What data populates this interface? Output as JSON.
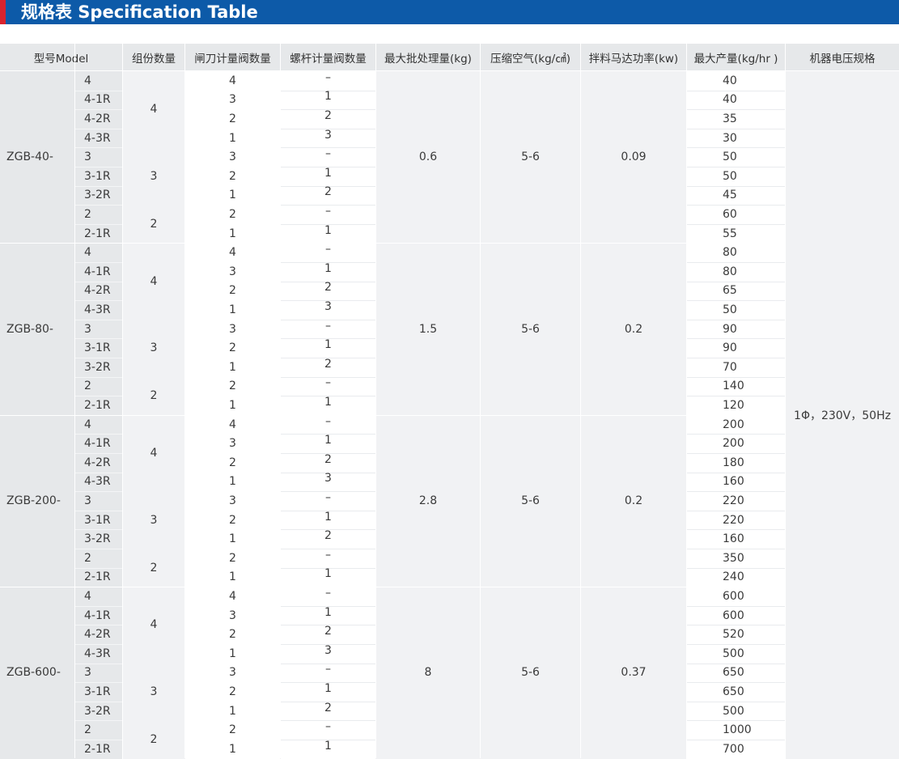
{
  "banner": {
    "title": "规格表 Specification Table",
    "accent_color": "#d9232e",
    "bg_color": "#0d5aa8"
  },
  "headers": {
    "model": "型号Model",
    "groups": "组份数量",
    "gate_valves": "闸刀计量阀数量",
    "screw_valves": "螺杆计量阀数量",
    "max_batch": "最大批处理量(kg)",
    "air": "压缩空气(kg/㎠)",
    "motor": "拌料马达功率(kw)",
    "max_output": "最大产量(kg/hr )",
    "voltage": "机器电压规格"
  },
  "voltage_value": "1Φ，230V，50Hz",
  "models": [
    {
      "name": "ZGB-40-",
      "batch": "0.6",
      "air": "5-6",
      "motor": "0.09",
      "rows": [
        {
          "sub": "4",
          "group": "4",
          "gate": "4",
          "screw": "–",
          "output": "40"
        },
        {
          "sub": "4-1R",
          "group": "4",
          "gate": "3",
          "screw": "1",
          "output": "40"
        },
        {
          "sub": "4-2R",
          "group": "4",
          "gate": "2",
          "screw": "2",
          "output": "35"
        },
        {
          "sub": "4-3R",
          "group": "4",
          "gate": "1",
          "screw": "3",
          "output": "30"
        },
        {
          "sub": "3",
          "group": "3",
          "gate": "3",
          "screw": "–",
          "output": "50"
        },
        {
          "sub": "3-1R",
          "group": "3",
          "gate": "2",
          "screw": "1",
          "output": "50"
        },
        {
          "sub": "3-2R",
          "group": "3",
          "gate": "1",
          "screw": "2",
          "output": "45"
        },
        {
          "sub": "2",
          "group": "2",
          "gate": "2",
          "screw": "–",
          "output": "60"
        },
        {
          "sub": "2-1R",
          "group": "2",
          "gate": "1",
          "screw": "1",
          "output": "55"
        }
      ]
    },
    {
      "name": "ZGB-80-",
      "batch": "1.5",
      "air": "5-6",
      "motor": "0.2",
      "rows": [
        {
          "sub": "4",
          "group": "4",
          "gate": "4",
          "screw": "–",
          "output": "80"
        },
        {
          "sub": "4-1R",
          "group": "4",
          "gate": "3",
          "screw": "1",
          "output": "80"
        },
        {
          "sub": "4-2R",
          "group": "4",
          "gate": "2",
          "screw": "2",
          "output": "65"
        },
        {
          "sub": "4-3R",
          "group": "4",
          "gate": "1",
          "screw": "3",
          "output": "50"
        },
        {
          "sub": "3",
          "group": "3",
          "gate": "3",
          "screw": "–",
          "output": "90"
        },
        {
          "sub": "3-1R",
          "group": "3",
          "gate": "2",
          "screw": "1",
          "output": "90"
        },
        {
          "sub": "3-2R",
          "group": "3",
          "gate": "1",
          "screw": "2",
          "output": "70"
        },
        {
          "sub": "2",
          "group": "2",
          "gate": "2",
          "screw": "–",
          "output": "140"
        },
        {
          "sub": "2-1R",
          "group": "2",
          "gate": "1",
          "screw": "1",
          "output": "120"
        }
      ]
    },
    {
      "name": "ZGB-200-",
      "batch": "2.8",
      "air": "5-6",
      "motor": "0.2",
      "rows": [
        {
          "sub": "4",
          "group": "4",
          "gate": "4",
          "screw": "–",
          "output": "200"
        },
        {
          "sub": "4-1R",
          "group": "4",
          "gate": "3",
          "screw": "1",
          "output": "200"
        },
        {
          "sub": "4-2R",
          "group": "4",
          "gate": "2",
          "screw": "2",
          "output": "180"
        },
        {
          "sub": "4-3R",
          "group": "4",
          "gate": "1",
          "screw": "3",
          "output": "160"
        },
        {
          "sub": "3",
          "group": "3",
          "gate": "3",
          "screw": "–",
          "output": "220"
        },
        {
          "sub": "3-1R",
          "group": "3",
          "gate": "2",
          "screw": "1",
          "output": "220"
        },
        {
          "sub": "3-2R",
          "group": "3",
          "gate": "1",
          "screw": "2",
          "output": "160"
        },
        {
          "sub": "2",
          "group": "2",
          "gate": "2",
          "screw": "–",
          "output": "350"
        },
        {
          "sub": "2-1R",
          "group": "2",
          "gate": "1",
          "screw": "1",
          "output": "240"
        }
      ]
    },
    {
      "name": "ZGB-600-",
      "batch": "8",
      "air": "5-6",
      "motor": "0.37",
      "rows": [
        {
          "sub": "4",
          "group": "4",
          "gate": "4",
          "screw": "–",
          "output": "600"
        },
        {
          "sub": "4-1R",
          "group": "4",
          "gate": "3",
          "screw": "1",
          "output": "600"
        },
        {
          "sub": "4-2R",
          "group": "4",
          "gate": "2",
          "screw": "2",
          "output": "520"
        },
        {
          "sub": "4-3R",
          "group": "4",
          "gate": "1",
          "screw": "3",
          "output": "500"
        },
        {
          "sub": "3",
          "group": "3",
          "gate": "3",
          "screw": "–",
          "output": "650"
        },
        {
          "sub": "3-1R",
          "group": "3",
          "gate": "2",
          "screw": "1",
          "output": "650"
        },
        {
          "sub": "3-2R",
          "group": "3",
          "gate": "1",
          "screw": "2",
          "output": "500"
        },
        {
          "sub": "2",
          "group": "2",
          "gate": "2",
          "screw": "–",
          "output": "1000"
        },
        {
          "sub": "2-1R",
          "group": "2",
          "gate": "1",
          "screw": "1",
          "output": "700"
        }
      ]
    }
  ]
}
